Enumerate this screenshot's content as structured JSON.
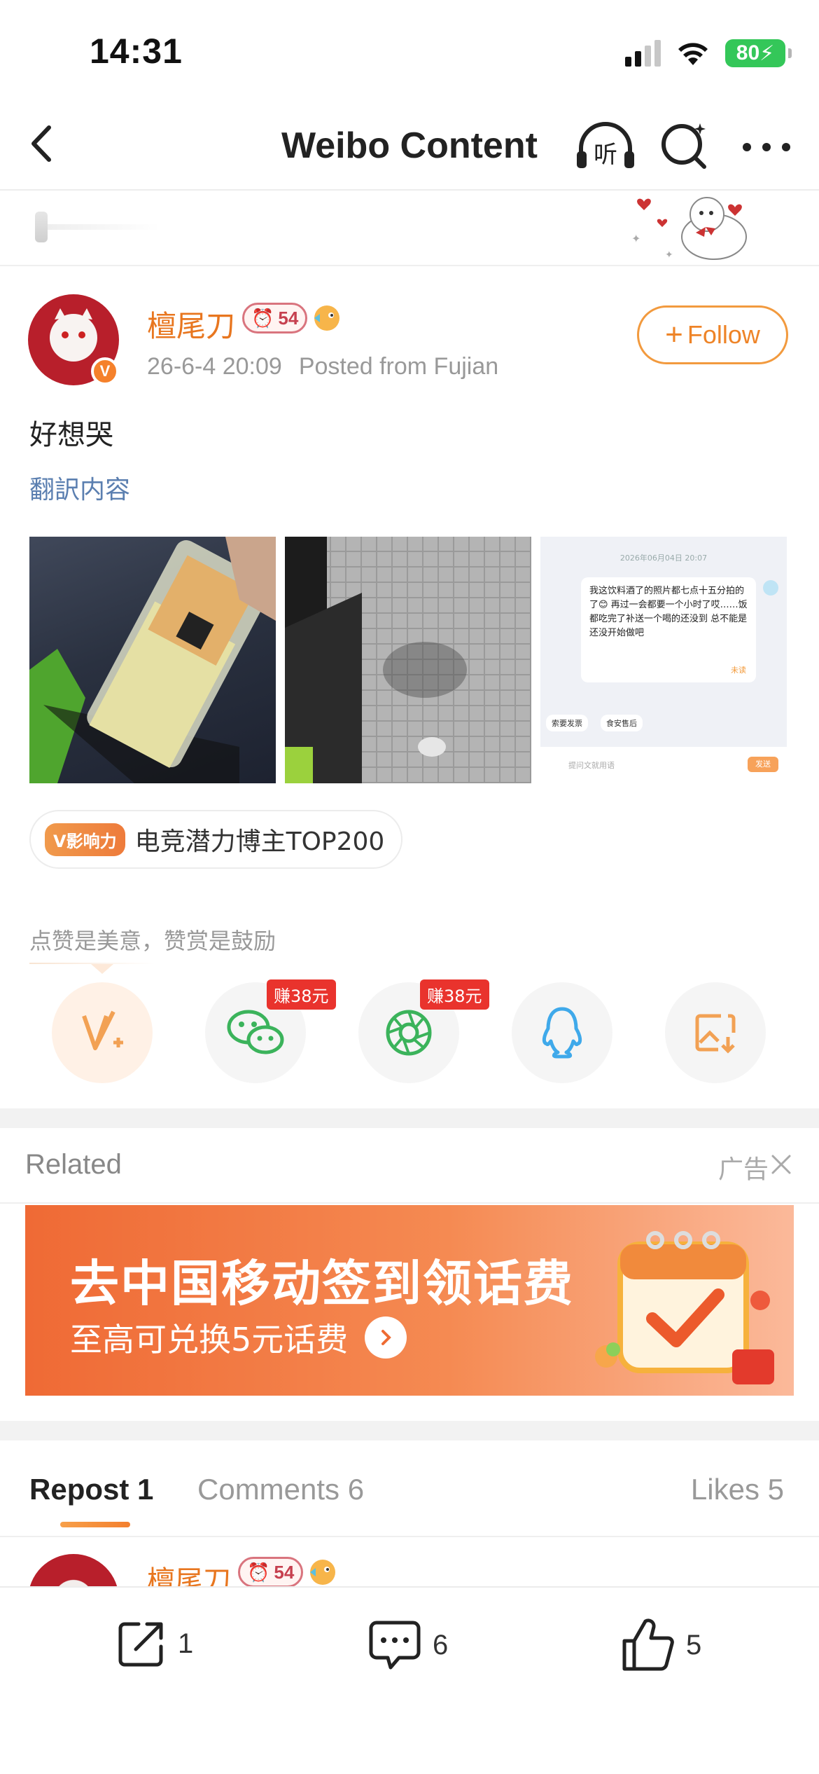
{
  "status_bar": {
    "time": "14:31",
    "battery": "80"
  },
  "nav": {
    "title": "Weibo Content",
    "listen_glyph": "听"
  },
  "post": {
    "author": "檀尾刀",
    "level": "54",
    "timestamp": "26-6-4 20:09",
    "location": "Posted from Fujian",
    "follow_label": "Follow",
    "text": "好想哭",
    "translate_label": "翻訳内容",
    "image_3": {
      "date": "2026年06月04日 20:07",
      "message": "我这饮料酒了的照片都七点十五分拍的了😊 再过一会都要一个小时了哎……饭都吃完了补送一个喝的还没到 总不能是还没开始做吧",
      "status": "未读",
      "quick_reply_1": "索要发票",
      "quick_reply_2": "食安售后",
      "input_placeholder": "提问文就用语",
      "send_label": "发送"
    }
  },
  "influence": {
    "badge": "V影响力",
    "label": "电竞潜力博主TOP200"
  },
  "reward": {
    "caption": "点赞是美意，赞赏是鼓励",
    "earn_badge": "赚38元"
  },
  "related": {
    "label": "Related",
    "ad_label": "广告"
  },
  "ad": {
    "title": "去中国移动签到领话费",
    "subtitle": "至高可兑换5元话费"
  },
  "tabs": [
    {
      "label": "Repost 1"
    },
    {
      "label": "Comments 6"
    },
    {
      "label": "Likes 5"
    }
  ],
  "bottom_bar": {
    "repost_count": "1",
    "comment_count": "6",
    "like_count": "5"
  },
  "colors": {
    "accent": "#ee8428",
    "username": "#e8761f",
    "link": "#5b7fb0",
    "earn": "#e9332d"
  }
}
